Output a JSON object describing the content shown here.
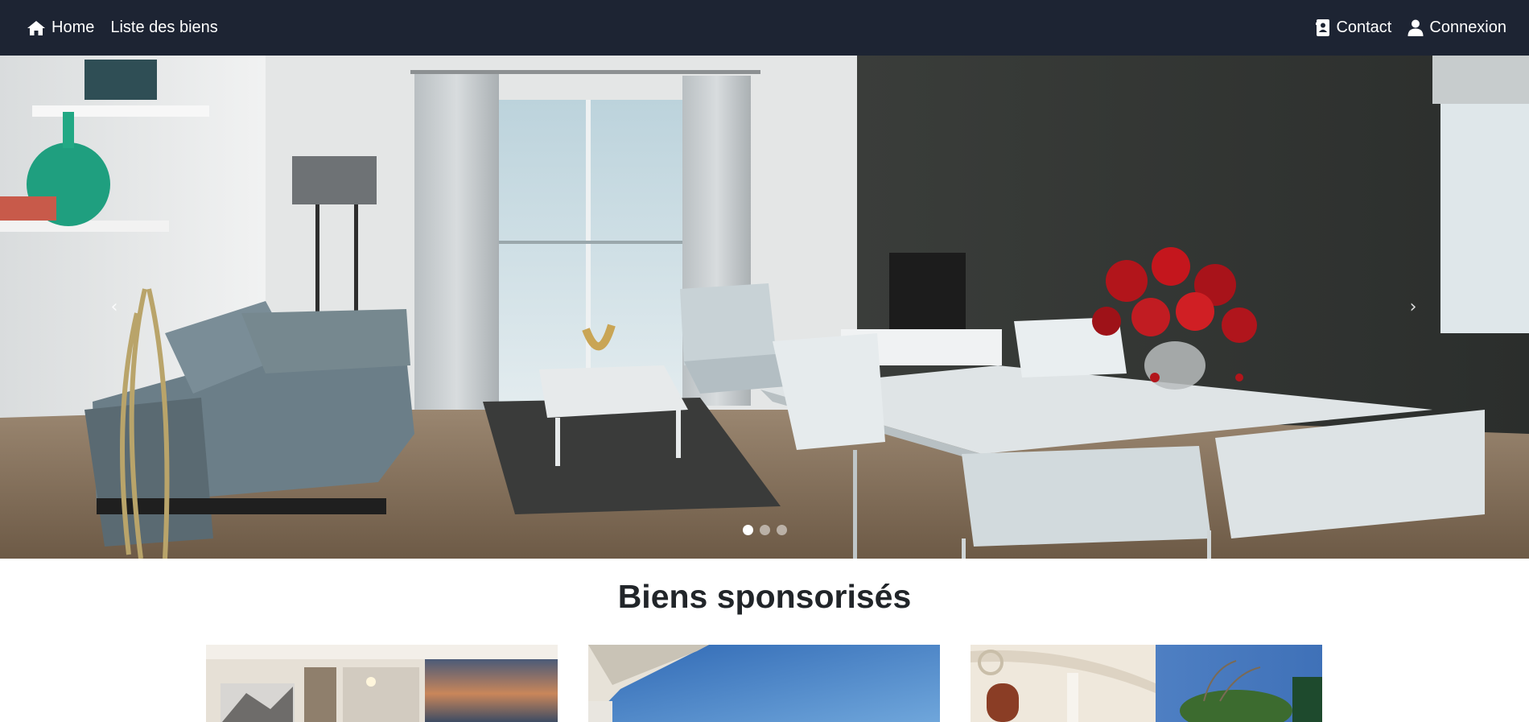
{
  "nav": {
    "home_label": "Home",
    "listing_label": "Liste des biens",
    "contact_label": "Contact",
    "login_label": "Connexion",
    "icons": {
      "home": "home-icon",
      "contact": "address-card-icon",
      "login": "user-icon"
    }
  },
  "carousel": {
    "prev_glyph": "‹",
    "next_glyph": "›",
    "slide_count": 3,
    "active_slide": 1
  },
  "sponsored": {
    "title": "Biens sponsorisés"
  },
  "colors": {
    "navbar_bg": "#1d2433",
    "nav_text": "#ffffff",
    "title_text": "#212529"
  }
}
